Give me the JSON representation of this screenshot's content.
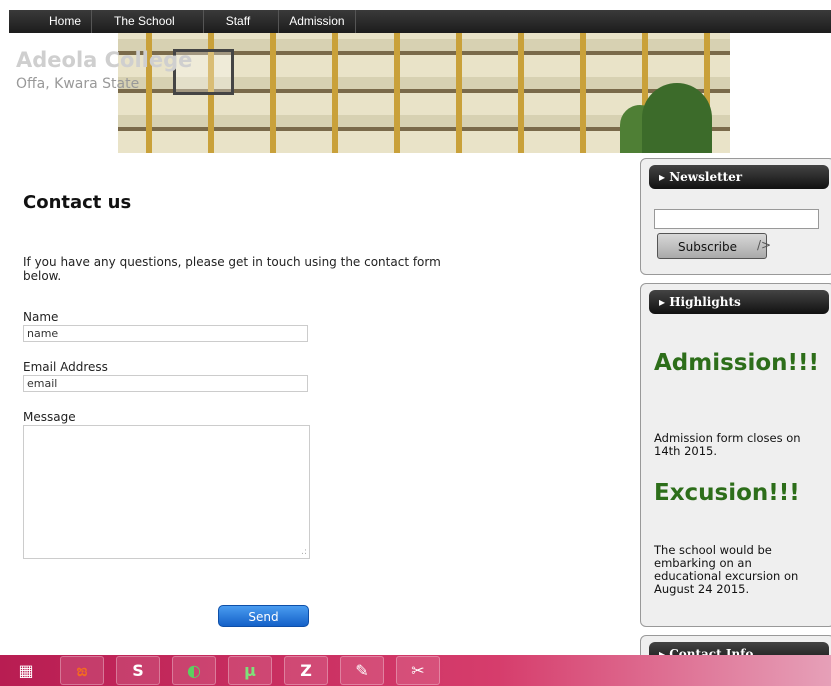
{
  "nav": {
    "items": [
      "Home",
      "The School",
      "Staff",
      "Admission"
    ]
  },
  "site": {
    "title": "Adeola College",
    "subtitle": "Offa, Kwara State"
  },
  "contact": {
    "heading": "Contact us",
    "intro": "If you have any questions, please get in touch using the contact form below.",
    "name_label": "Name",
    "name_value": "name",
    "email_label": "Email Address",
    "email_value": "email",
    "message_label": "Message",
    "send_label": "Send"
  },
  "newsletter": {
    "title": "Newsletter",
    "subscribe_label": "Subscribe",
    "tail": "/>"
  },
  "highlights": {
    "title": "Highlights",
    "items": [
      {
        "title": "Admission!!!",
        "text": "Admission form closes on 14th 2015."
      },
      {
        "title": "Excusion!!!",
        "text": "The school would be embarking on an educational excursion on August 24 2015."
      }
    ]
  },
  "contact_info": {
    "title": "Contact Info"
  },
  "taskbar": {
    "icons": [
      "start-icon",
      "xampp-icon",
      "sublime-icon",
      "chrome-icon",
      "utorrent-icon",
      "filezilla-icon",
      "notepad-icon",
      "snipping-tool-icon"
    ],
    "glyphs": [
      "▦",
      "ಙ",
      "S",
      "◐",
      "µ",
      "Z",
      "✎",
      "✂"
    ]
  }
}
